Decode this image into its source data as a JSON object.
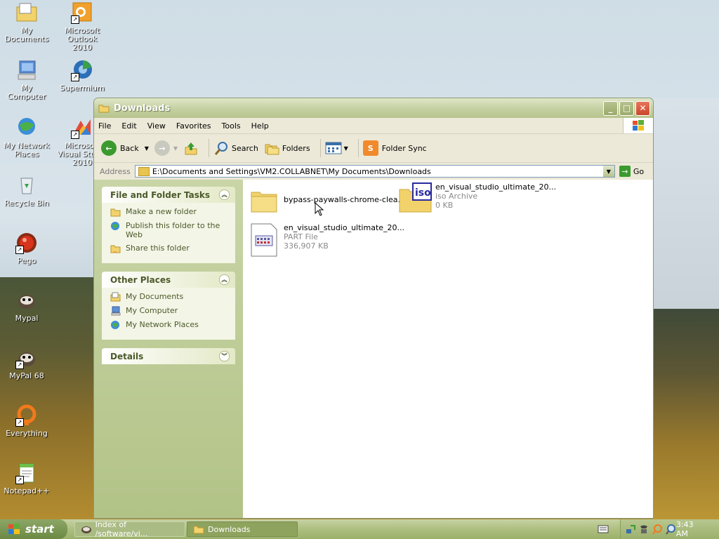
{
  "desktop": {
    "icons": [
      {
        "label": "My Documents"
      },
      {
        "label": "Microsoft Outlook 2010"
      },
      {
        "label": "My Computer"
      },
      {
        "label": "Supermium"
      },
      {
        "label": "My Network Places"
      },
      {
        "label": "Microsoft Visual Studio 2010"
      },
      {
        "label": "Recycle Bin"
      },
      {
        "label": "Pego"
      },
      {
        "label": "Mypal"
      },
      {
        "label": "MyPal 68"
      },
      {
        "label": "Everything"
      },
      {
        "label": "Notepad++"
      }
    ]
  },
  "window": {
    "title": "Downloads",
    "menu": [
      "File",
      "Edit",
      "View",
      "Favorites",
      "Tools",
      "Help"
    ],
    "toolbar": {
      "back": "Back",
      "search": "Search",
      "folders": "Folders",
      "folder_sync": "Folder Sync"
    },
    "address": {
      "label": "Address",
      "value": "E:\\Documents and Settings\\VM2.COLLABNET\\My Documents\\Downloads",
      "go": "Go"
    },
    "tasks_panel": {
      "title": "File and Folder Tasks",
      "items": [
        "Make a new folder",
        "Publish this folder to the Web",
        "Share this folder"
      ]
    },
    "places_panel": {
      "title": "Other Places",
      "items": [
        "My Documents",
        "My Computer",
        "My Network Places"
      ]
    },
    "details_panel": {
      "title": "Details"
    },
    "files": [
      {
        "name": "bypass-paywalls-chrome-clea...",
        "type": "",
        "size": "",
        "icon": "folder-icon"
      },
      {
        "name": "en_visual_studio_ultimate_20...",
        "type": "iso Archive",
        "size": "0 KB",
        "icon": "iso-archive-icon"
      },
      {
        "name": "en_visual_studio_ultimate_20...",
        "type": "PART File",
        "size": "336,907 KB",
        "icon": "part-file-icon"
      }
    ]
  },
  "taskbar": {
    "start": "start",
    "tasks": [
      {
        "label": "Index of /software/vi..."
      },
      {
        "label": "Downloads"
      }
    ],
    "clock": "3:43 AM"
  },
  "colors": {
    "title_gradient_start": "#dfe6c8",
    "left_pane": "#c9d5a7",
    "taskbar": "#aebf80"
  }
}
